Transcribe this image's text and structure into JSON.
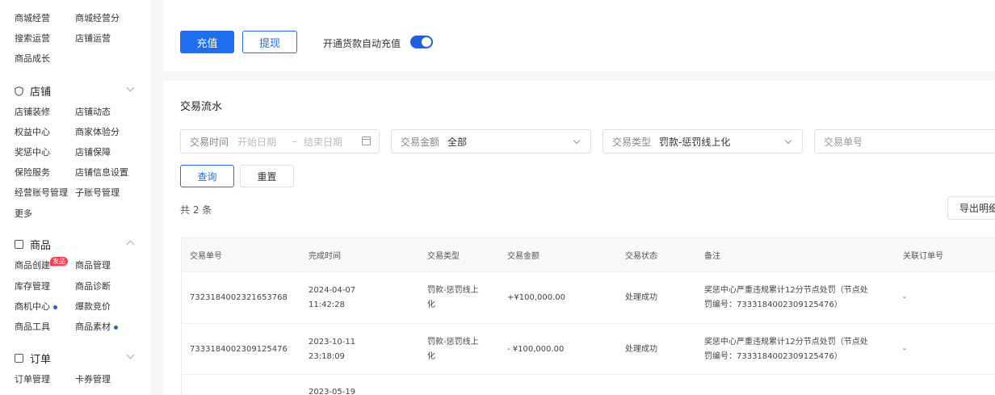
{
  "sidebar": {
    "rows_top": [
      {
        "left": "商城经营",
        "right": "商城经营分"
      },
      {
        "left": "搜索运营",
        "right": "店铺运营"
      },
      {
        "left": "商品成长",
        "right": ""
      }
    ],
    "shop_section": {
      "title": "店铺",
      "rows": [
        {
          "left": "店铺装修",
          "right": "店铺动态"
        },
        {
          "left": "权益中心",
          "right": "商家体验分"
        },
        {
          "left": "奖惩中心",
          "right": "店铺保障"
        },
        {
          "left": "保险服务",
          "right": "店铺信息设置"
        },
        {
          "left": "经营账号管理",
          "right": "子账号管理"
        },
        {
          "left": "更多",
          "right": ""
        }
      ]
    },
    "product_section": {
      "title": "商品",
      "badge": "发品",
      "rows": [
        {
          "left": "商品创建",
          "right": "商品管理"
        },
        {
          "left": "库存管理",
          "right": "商品诊断"
        },
        {
          "left": "商机中心",
          "right": "爆款竞价"
        },
        {
          "left": "商品工具",
          "right": "商品素材"
        }
      ]
    },
    "order_section": {
      "title": "订单",
      "rows": [
        {
          "left": "订单管理",
          "right": "卡券管理"
        }
      ]
    }
  },
  "top": {
    "recharge_label": "充值",
    "withdraw_label": "提现",
    "auto_recharge_label": "开通货款自动充值",
    "auto_recharge_on": true
  },
  "filters": {
    "section_title": "交易流水",
    "time_label": "交易时间",
    "start_placeholder": "开始日期",
    "separator": "–",
    "end_placeholder": "结束日期",
    "amount_label": "交易金额",
    "amount_value": "全部",
    "type_label": "交易类型",
    "type_value": "罚款-惩罚线上化",
    "order_no_placeholder": "交易单号",
    "query_label": "查询",
    "reset_label": "重置",
    "total_text": "共 2 条",
    "export_label": "导出明细"
  },
  "table": {
    "headers": [
      "交易单号",
      "完成时间",
      "交易类型",
      "交易金额",
      "交易状态",
      "备注",
      "关联订单号"
    ],
    "rows": [
      {
        "order_no": "7323184002321653768",
        "time_date": "2024-04-07",
        "time_clock": "11:42:28",
        "type_l1": "罚款-惩罚线上",
        "type_l2": "化",
        "amount": "+¥100,000.00",
        "status": "处理成功",
        "note_l1": "奖惩中心严重违规累计12分节点处罚（节点处",
        "note_l2": "罚编号：7333184002309125476）",
        "related": "-"
      },
      {
        "order_no": "7333184002309125476",
        "time_date": "2023-10-11",
        "time_clock": "23:18:09",
        "type_l1": "罚款-惩罚线上",
        "type_l2": "化",
        "amount": "- ¥100,000.00",
        "status": "处理成功",
        "note_l1": "奖惩中心严重违规累计12分节点处罚（节点处",
        "note_l2": "罚编号：7333184002309125476）",
        "related": "-"
      },
      {
        "time_date": "2023-05-19"
      }
    ]
  },
  "colors": {
    "primary": "#1f6ef0",
    "badge": "#ff3b4a",
    "dot": "#1f5fe0"
  }
}
